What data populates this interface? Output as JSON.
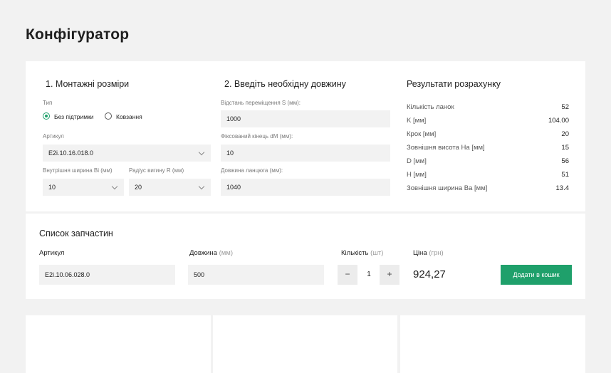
{
  "page": {
    "title": "Конфігуратор"
  },
  "mounting": {
    "title": "1. Монтажні розміри",
    "type_label": "Тип",
    "options": [
      "Без підтримки",
      "Ковзання"
    ],
    "selected_option": "Без підтримки",
    "article_label": "Артикул",
    "article_value": "E2i.10.16.018.0",
    "width_label": "Внутрішня ширина Bi (мм)",
    "width_value": "10",
    "radius_label": "Радіус вигину R (мм)",
    "radius_value": "20"
  },
  "length": {
    "title": "2. Введіть необхідну довжину",
    "s_label": "Відстань переміщення S (мм):",
    "s_value": "1000",
    "dm_label": "Фіксований кінець dM (мм):",
    "dm_value": "10",
    "chain_label": "Довжина ланцюга (мм):",
    "chain_value": "1040"
  },
  "results": {
    "title": "Результати розрахунку",
    "rows": [
      {
        "key": "Кількість ланок",
        "value": "52"
      },
      {
        "key": "K [мм]",
        "value": "104.00"
      },
      {
        "key": "Крок [мм]",
        "value": "20"
      },
      {
        "key": "Зовнішня висота Ha [мм]",
        "value": "15"
      },
      {
        "key": "D [мм]",
        "value": "56"
      },
      {
        "key": "H [мм]",
        "value": "51"
      },
      {
        "key": "Зовнішня ширина Ba [мм]",
        "value": "13.4"
      }
    ]
  },
  "parts": {
    "title": "Список запчастин",
    "col_article": "Артикул",
    "col_length": "Довжина",
    "col_length_unit": "(мм)",
    "col_qty": "Кількість",
    "col_qty_unit": "(шт)",
    "col_price": "Ціна",
    "col_price_unit": "(грн)",
    "article": "E2i.10.06.028.0",
    "length": "500",
    "qty": "1",
    "minus": "−",
    "plus": "+",
    "price": "924,27",
    "add_button": "Додати в кошик"
  },
  "colors": {
    "accent": "#1fa06b",
    "background": "#f2f2f2",
    "panel": "#ffffff",
    "field": "#f2f2f2"
  }
}
